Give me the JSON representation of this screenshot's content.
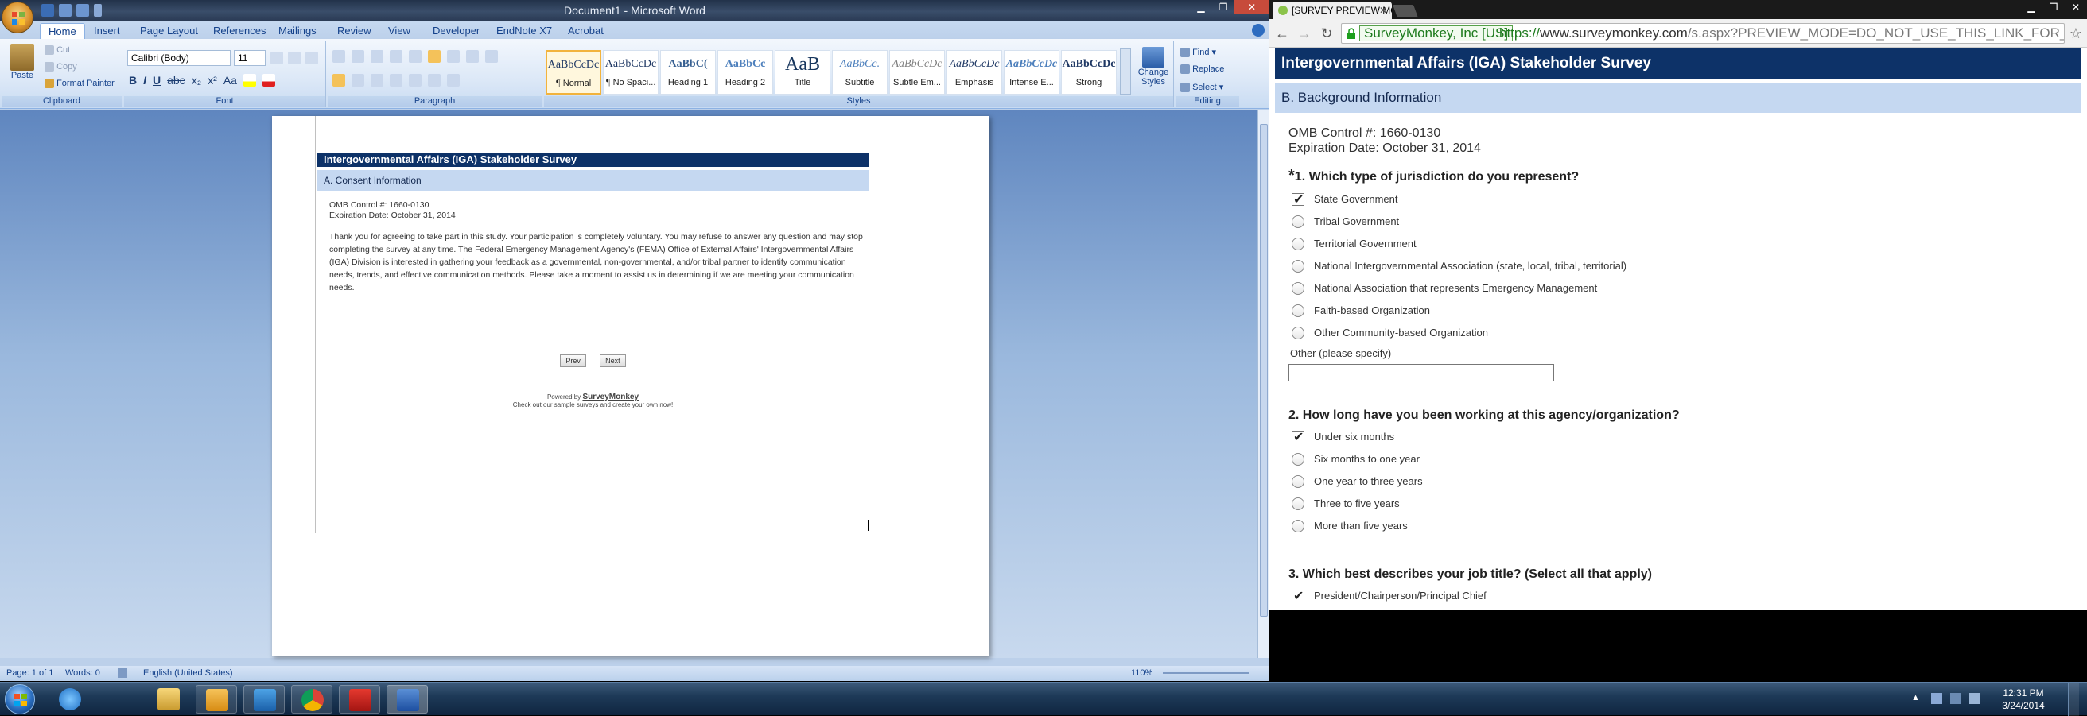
{
  "word": {
    "title": "Document1 - Microsoft Word",
    "tabs": [
      "Home",
      "Insert",
      "Page Layout",
      "References",
      "Mailings",
      "Review",
      "View",
      "Developer",
      "EndNote X7",
      "Acrobat"
    ],
    "clipboard": {
      "paste": "Paste",
      "cut": "Cut",
      "copy": "Copy",
      "format_painter": "Format Painter",
      "group": "Clipboard"
    },
    "font": {
      "name": "Calibri (Body)",
      "size": "11",
      "group": "Font"
    },
    "paragraph": {
      "group": "Paragraph"
    },
    "styles": {
      "group": "Styles",
      "tiles": [
        {
          "sample": "AaBbCcDc",
          "name": "¶ Normal"
        },
        {
          "sample": "AaBbCcDc",
          "name": "¶ No Spaci..."
        },
        {
          "sample": "AaBbC(",
          "name": "Heading 1"
        },
        {
          "sample": "AaBbCc",
          "name": "Heading 2"
        },
        {
          "sample": "AaB",
          "name": "Title"
        },
        {
          "sample": "AaBbCc.",
          "name": "Subtitle"
        },
        {
          "sample": "AaBbCcDc",
          "name": "Subtle Em..."
        },
        {
          "sample": "AaBbCcDc",
          "name": "Emphasis"
        },
        {
          "sample": "AaBbCcDc",
          "name": "Intense E..."
        },
        {
          "sample": "AaBbCcDc",
          "name": "Strong"
        }
      ],
      "change_styles": "Change Styles"
    },
    "editing": {
      "find": "Find",
      "replace": "Replace",
      "select": "Select",
      "group": "Editing"
    },
    "status": {
      "page": "Page: 1 of 1",
      "words": "Words: 0",
      "language": "English (United States)",
      "zoom": "110%"
    },
    "document": {
      "survey_title": "Intergovernmental Affairs (IGA) Stakeholder Survey",
      "section": "A. Consent Information",
      "omb": "OMB Control #: 1660-0130",
      "expiration": "Expiration Date: October 31, 2014",
      "body": "Thank you for agreeing to take part in this study. Your participation is completely voluntary. You may refuse to answer any question and may stop completing the survey at any time. The Federal Emergency Management Agency's (FEMA) Office of External Affairs' Intergovernmental Affairs (IGA) Division is interested in gathering your feedback as a governmental, non-governmental, and/or tribal partner to identify communication needs, trends, and effective communication methods. Please take a moment to assist us in determining if we are meeting your communication needs.",
      "prev": "Prev",
      "next": "Next",
      "powered_prefix": "Powered by",
      "powered_brand": "SurveyMonkey",
      "powered_sub": "Check out our sample surveys and create your own now!"
    }
  },
  "chrome": {
    "tab_title": "[SURVEY PREVIEW MODE] ",
    "ev_label": "SurveyMonkey, Inc [US]",
    "url_scheme": "https://",
    "url_host": "www.surveymonkey.com",
    "url_path": "/s.aspx?PREVIEW_MODE=DO_NOT_USE_THIS_LINK_FOR_COLLEC"
  },
  "survey": {
    "title": "Intergovernmental Affairs (IGA) Stakeholder Survey",
    "section": "B. Background Information",
    "omb": "OMB Control #: 1660-0130",
    "expiration": "Expiration Date: October 31, 2014",
    "q1": {
      "required_mark": "*",
      "text": "1. Which type of jurisdiction do you represent?",
      "options": [
        {
          "label": "State Government",
          "selected": true
        },
        {
          "label": "Tribal Government",
          "selected": false
        },
        {
          "label": "Territorial Government",
          "selected": false
        },
        {
          "label": "National Intergovernmental Association (state, local, tribal, territorial)",
          "selected": false
        },
        {
          "label": "National Association that represents Emergency Management",
          "selected": false
        },
        {
          "label": "Faith-based Organization",
          "selected": false
        },
        {
          "label": "Other Community-based Organization",
          "selected": false
        }
      ],
      "other_label": "Other (please specify)"
    },
    "q2": {
      "text": "2. How long have you been working at this agency/organization?",
      "options": [
        {
          "label": "Under six months",
          "selected": true
        },
        {
          "label": "Six months to one year",
          "selected": false
        },
        {
          "label": "One year to three years",
          "selected": false
        },
        {
          "label": "Three to five years",
          "selected": false
        },
        {
          "label": "More than five years",
          "selected": false
        }
      ]
    },
    "q3": {
      "text": "3. Which best describes your job title? (Select all that apply)",
      "options": [
        {
          "label": "President/Chairperson/Principal Chief",
          "selected": true
        }
      ]
    }
  },
  "taskbar": {
    "time": "12:31 PM",
    "date": "3/24/2014",
    "apps": [
      "internet-explorer",
      "file-explorer",
      "outlook",
      "lync",
      "chrome",
      "acrobat",
      "word"
    ]
  }
}
